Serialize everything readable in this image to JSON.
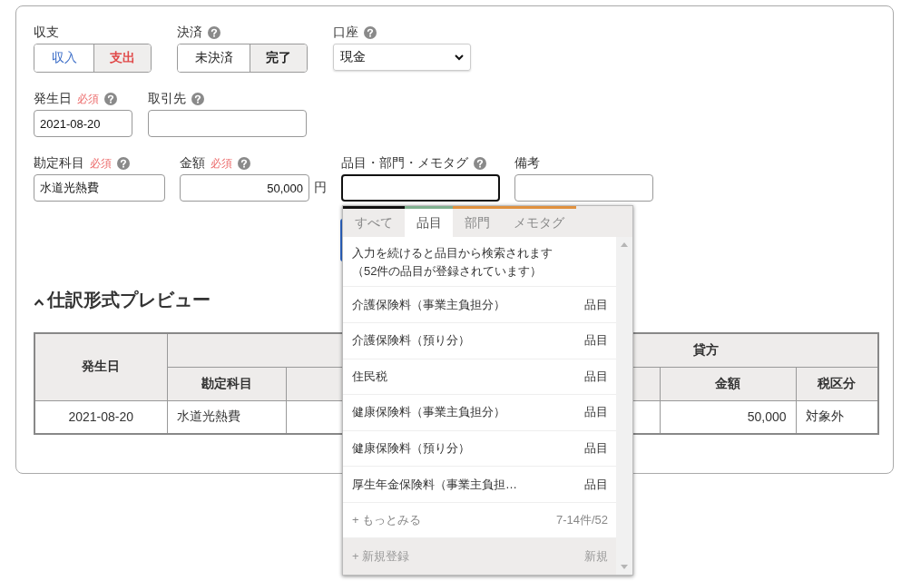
{
  "form_rows": [
    [
      {
        "kind": "segmented",
        "label": "収支",
        "help": false,
        "segments": [
          {
            "label": "収入",
            "selected": false,
            "color": "#3a6cc7"
          },
          {
            "label": "支出",
            "selected": true,
            "color": "#e04848"
          }
        ]
      },
      {
        "kind": "segmented",
        "label": "決済",
        "help": true,
        "segments": [
          {
            "label": "未決済",
            "selected": false,
            "color": "#222222"
          },
          {
            "label": "完了",
            "selected": true,
            "color": "#222222"
          }
        ]
      },
      {
        "kind": "select",
        "label": "口座",
        "help": true,
        "value": "現金"
      }
    ],
    [
      {
        "kind": "input",
        "label": "発生日",
        "badge": "必須",
        "help": true,
        "value": "2021-08-20",
        "focused": false
      },
      {
        "kind": "input",
        "label": "取引先",
        "help": true,
        "focused": false
      }
    ],
    [
      {
        "kind": "input",
        "label": "勘定科目",
        "badge": "必須",
        "help": true,
        "value": "水道光熱費",
        "focused": false
      },
      {
        "kind": "input",
        "label": "金額",
        "badge": "必須",
        "help": true,
        "value": "50,000",
        "unit": "円",
        "focused": false
      },
      {
        "kind": "input",
        "label": "品目・部門・メモタグ",
        "help": true,
        "focused": true,
        "suggest": true
      },
      {
        "kind": "input",
        "label": "備考",
        "help": false,
        "focused": false
      }
    ]
  ],
  "suggest": {
    "tabs": [
      {
        "label": "すべて",
        "selected": false,
        "color": "#111111"
      },
      {
        "label": "品目",
        "selected": true,
        "color": "#7fb08f"
      },
      {
        "label": "部門",
        "selected": false,
        "color": "#e0913f"
      },
      {
        "label": "メモタグ",
        "selected": false,
        "color": "#e0913f"
      }
    ],
    "hint": [
      "入力を続けると品目から検索されます",
      "（52件の品目が登録されています）"
    ],
    "items": [
      {
        "name": "介護保険料（事業主負担分）",
        "type": "品目"
      },
      {
        "name": "介護保険料（預り分）",
        "type": "品目"
      },
      {
        "name": "住民税",
        "type": "品目"
      },
      {
        "name": "健康保険料（事業主負担分）",
        "type": "品目"
      },
      {
        "name": "健康保険料（預り分）",
        "type": "品目"
      },
      {
        "name": "厚生年金保険料（事業主負担…",
        "type": "品目"
      }
    ],
    "more": {
      "label": "+ もっとみる",
      "count": "7-14件/52"
    },
    "create": {
      "label": "+ 新規登録",
      "tag": "新規"
    }
  },
  "preview": {
    "title": "仕訳形式プレビュー",
    "expanded": true,
    "credit_label": "貸方",
    "columns": [
      "発生日",
      "勘定科目",
      null,
      null,
      null,
      "金額",
      "税区分"
    ],
    "rows": [
      {
        "cells": [
          "2021-08-20",
          "水道光熱費",
          null,
          null,
          null,
          "50,000",
          "対象外"
        ]
      }
    ]
  }
}
